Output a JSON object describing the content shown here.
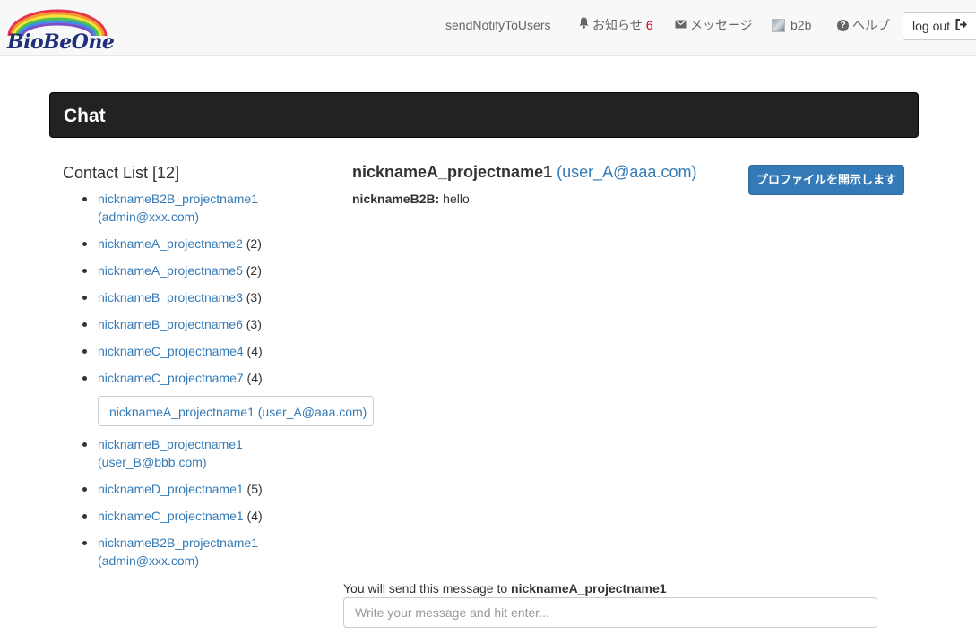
{
  "brand": {
    "logo_text": "BioBeOne"
  },
  "nav": {
    "send_notify": "sendNotifyToUsers",
    "notices_label": "お知らせ",
    "notices_count": "6",
    "messages_label": "メッセージ",
    "user_label": "b2b",
    "help_label": "ヘルプ",
    "logout_label": "log out"
  },
  "chat": {
    "title": "Chat",
    "contact_list_title": "Contact List [12]",
    "contacts": [
      {
        "name": "nicknameB2B_projectname1",
        "email": "(admin@xxx.com)",
        "count": ""
      },
      {
        "name": "nicknameA_projectname2",
        "email": "",
        "count": "(2)"
      },
      {
        "name": "nicknameA_projectname5",
        "email": "",
        "count": "(2)"
      },
      {
        "name": "nicknameB_projectname3",
        "email": "",
        "count": "(3)"
      },
      {
        "name": "nicknameB_projectname6",
        "email": "",
        "count": "(3)"
      },
      {
        "name": "nicknameC_projectname4",
        "email": "",
        "count": "(4)"
      },
      {
        "name": "nicknameC_projectname7",
        "email": "",
        "count": "(4)"
      }
    ],
    "active_contact": "nicknameA_projectname1 (user_A@aaa.com)",
    "contacts_after": [
      {
        "name": "nicknameB_projectname1",
        "email": "(user_B@bbb.com)",
        "count": ""
      },
      {
        "name": "nicknameD_projectname1",
        "email": "",
        "count": "(5)"
      },
      {
        "name": "nicknameC_projectname1",
        "email": "",
        "count": "(4)"
      },
      {
        "name": "nicknameB2B_projectname1",
        "email": "(admin@xxx.com)",
        "count": ""
      }
    ],
    "recipient_name": "nicknameA_projectname1",
    "recipient_email": "(user_A@aaa.com)",
    "profile_button": "プロファイルを開示します",
    "messages": [
      {
        "sender": "nicknameB2B:",
        "text": "hello"
      }
    ],
    "send_note_prefix": "You will send this message to",
    "send_note_target": "nicknameA_projectname1",
    "input_placeholder": "Write your message and hit enter..."
  },
  "colors": {
    "link": "#337ab7",
    "primary": "#337ab7",
    "header_bg": "#222222",
    "badge": "#d9001b"
  }
}
